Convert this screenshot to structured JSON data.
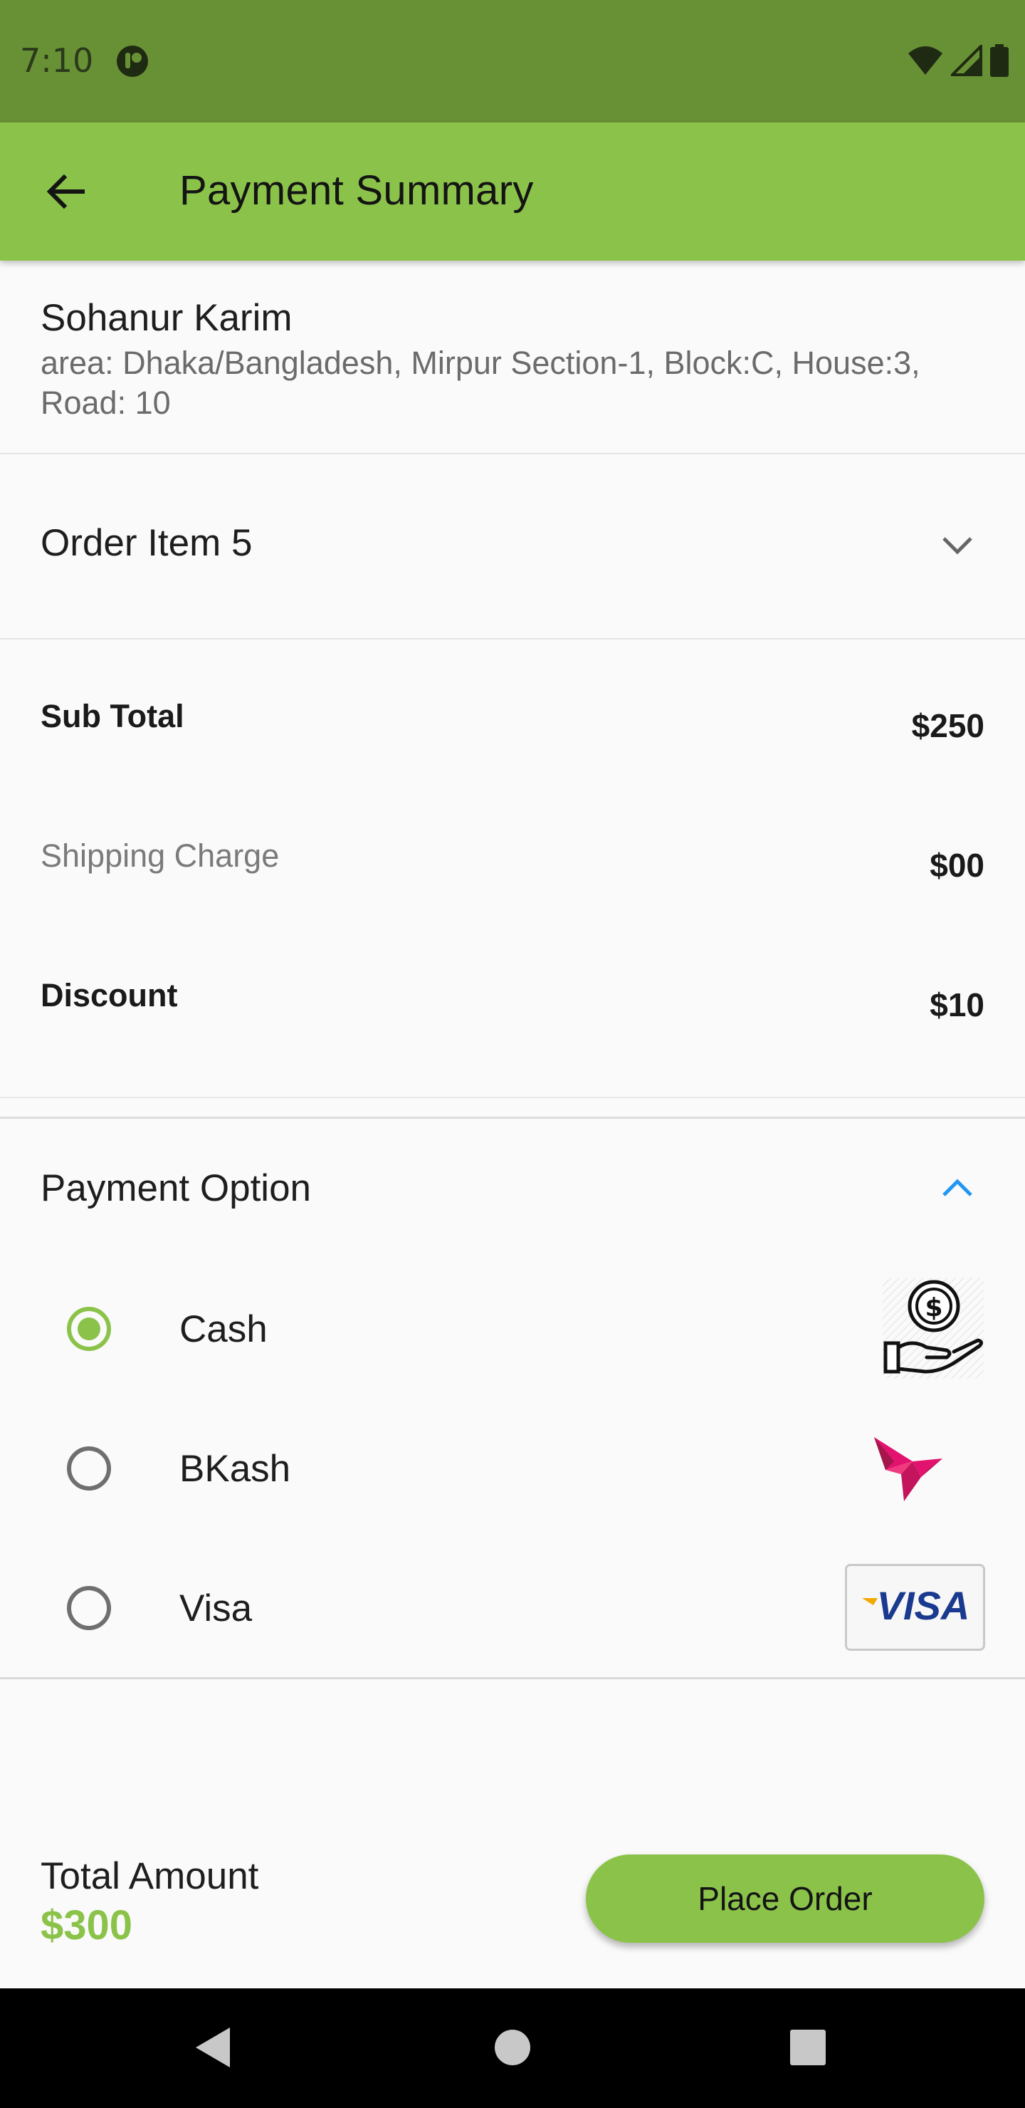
{
  "status_bar": {
    "time": "7:10",
    "icons": [
      "app-notification-icon",
      "wifi-icon",
      "cellular-signal-icon",
      "battery-icon"
    ]
  },
  "app_bar": {
    "title": "Payment Summary",
    "back_icon": "arrow-left-icon"
  },
  "address": {
    "name": "Sohanur Karim",
    "line": "area: Dhaka/Bangladesh, Mirpur Section-1, Block:C, House:3, Road: 10"
  },
  "order": {
    "label": "Order Item 5",
    "icon": "chevron-down-icon"
  },
  "totals": {
    "sub_total_label": "Sub Total",
    "sub_total_value": "$250",
    "shipping_label": "Shipping Charge",
    "shipping_value": "$00",
    "discount_label": "Discount",
    "discount_value": "$10"
  },
  "payment": {
    "title": "Payment Option",
    "icon": "chevron-up-icon",
    "selected": "Cash",
    "options": [
      {
        "label": "Cash",
        "icon": "cash-in-hand-icon"
      },
      {
        "label": "BKash",
        "icon": "bkash-logo-icon"
      },
      {
        "label": "Visa",
        "icon": "visa-card-icon",
        "icon_text": "VISA"
      }
    ]
  },
  "footer": {
    "total_label": "Total Amount",
    "total_value": "$300",
    "button_label": "Place Order"
  },
  "nav_bar": {
    "icons": [
      "back-triangle-icon",
      "home-circle-icon",
      "recents-square-icon"
    ]
  },
  "colors": {
    "status_bar": "#689136",
    "app_bar": "#8bc34a",
    "accent": "#8bc34a",
    "chevron_active": "#2196f3",
    "bkash": "#d81b60",
    "visa_blue": "#1a3a8f",
    "visa_gold": "#f2a900"
  }
}
